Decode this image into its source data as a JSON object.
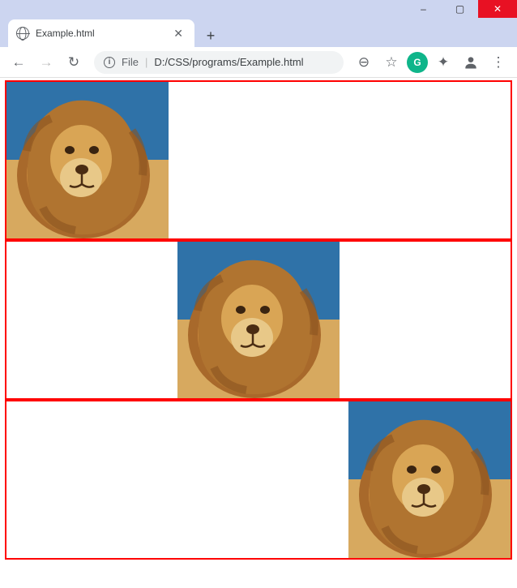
{
  "window": {
    "minimize": "–",
    "maximize": "▢",
    "close": "✕"
  },
  "tab": {
    "title": "Example.html",
    "close": "✕",
    "new_tab": "+"
  },
  "toolbar": {
    "back": "←",
    "forward": "→",
    "reload": "↻"
  },
  "omnibox": {
    "prefix_label": "File",
    "url": "D:/CSS/programs/Example.html"
  },
  "actions": {
    "zoom": "⊖",
    "star": "☆",
    "grammarly": "G",
    "extensions": "✦",
    "profile": "👤",
    "menu": "⋮"
  },
  "content": {
    "boxes": [
      {
        "position": "left",
        "image": "lion"
      },
      {
        "position": "center",
        "image": "lion"
      },
      {
        "position": "right",
        "image": "lion"
      }
    ],
    "image_alt": "lion"
  }
}
